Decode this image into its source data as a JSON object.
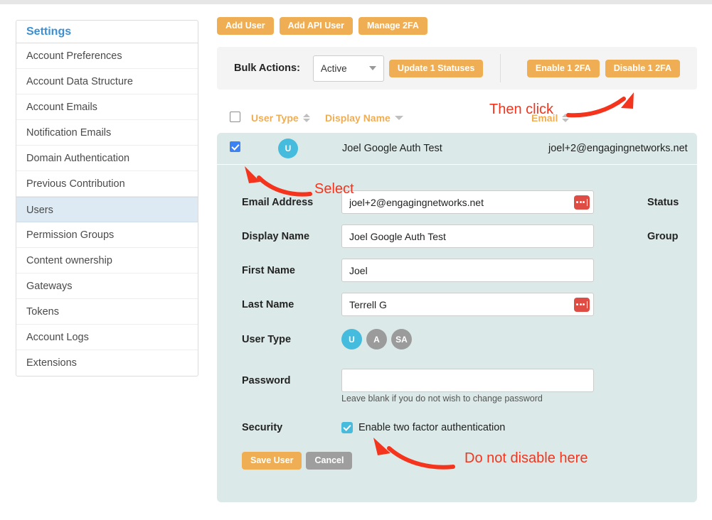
{
  "sidebar": {
    "header": "Settings",
    "items": [
      {
        "label": "Account Preferences",
        "active": false
      },
      {
        "label": "Account Data Structure",
        "active": false
      },
      {
        "label": "Account Emails",
        "active": false
      },
      {
        "label": "Notification Emails",
        "active": false
      },
      {
        "label": "Domain Authentication",
        "active": false
      },
      {
        "label": "Previous Contribution",
        "active": false
      },
      {
        "label": "Users",
        "active": true
      },
      {
        "label": "Permission Groups",
        "active": false
      },
      {
        "label": "Content ownership",
        "active": false
      },
      {
        "label": "Gateways",
        "active": false
      },
      {
        "label": "Tokens",
        "active": false
      },
      {
        "label": "Account Logs",
        "active": false
      },
      {
        "label": "Extensions",
        "active": false
      }
    ]
  },
  "toolbar": {
    "add_user": "Add User",
    "add_api_user": "Add API User",
    "manage_2fa": "Manage 2FA"
  },
  "bulk_actions": {
    "label": "Bulk Actions:",
    "status_value": "Active",
    "status_options": [
      "Active"
    ],
    "update_label": "Update 1 Statuses",
    "enable_2fa": "Enable 1 2FA",
    "disable_2fa": "Disable 1 2FA"
  },
  "table": {
    "headers": {
      "user_type": "User Type",
      "display_name": "Display Name",
      "email": "Email"
    },
    "row": {
      "avatar_initial": "U",
      "display_name": "Joel Google Auth Test",
      "email": "joel+2@engagingnetworks.net",
      "checked": true
    }
  },
  "form": {
    "email_label": "Email Address",
    "email_value": "joel+2@engagingnetworks.net",
    "display_label": "Display Name",
    "display_value": "Joel Google Auth Test",
    "first_label": "First Name",
    "first_value": "Joel",
    "last_label": "Last Name",
    "last_value": "Terrell G",
    "user_type_label": "User Type",
    "user_type_options": [
      {
        "label": "U",
        "selected": true
      },
      {
        "label": "A",
        "selected": false
      },
      {
        "label": "SA",
        "selected": false
      }
    ],
    "password_label": "Password",
    "password_value": "",
    "password_hint": "Leave blank if you do not wish to change password",
    "security_label": "Security",
    "two_factor_label": "Enable two factor authentication",
    "two_factor_checked": true,
    "status_label": "Status",
    "group_label": "Group",
    "save_label": "Save User",
    "cancel_label": "Cancel"
  },
  "annotations": {
    "then_click": "Then click",
    "select": "Select",
    "do_not_disable": "Do not disable here"
  },
  "colors": {
    "accent_orange": "#efae54",
    "annotation_red": "#f4341d",
    "panel_teal": "#dbeae8",
    "avatar_blue": "#45bcdd",
    "sidebar_link": "#3d8fd1"
  }
}
